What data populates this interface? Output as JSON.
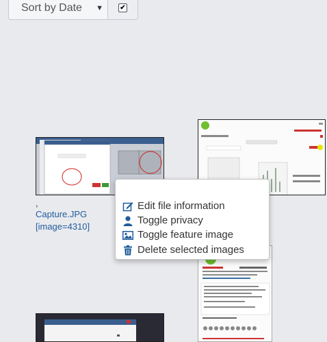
{
  "toolbar": {
    "sort_label": "Sort by Date",
    "sort_arrow": "▼",
    "checkbox_checked": true
  },
  "images": [
    {
      "caption_prefix": ",",
      "filename": "Capture.JPG",
      "tag": "[image=4310]"
    }
  ],
  "context_menu": {
    "items": [
      {
        "label": "Edit file information",
        "icon": "edit-icon"
      },
      {
        "label": "Toggle privacy",
        "icon": "user-icon"
      },
      {
        "label": "Toggle feature image",
        "icon": "image-icon"
      },
      {
        "label": "Delete selected images",
        "icon": "trash-icon"
      }
    ]
  },
  "colors": {
    "background": "#e9eaee",
    "link": "#1f5d9c",
    "icon": "#1f5d9c"
  }
}
